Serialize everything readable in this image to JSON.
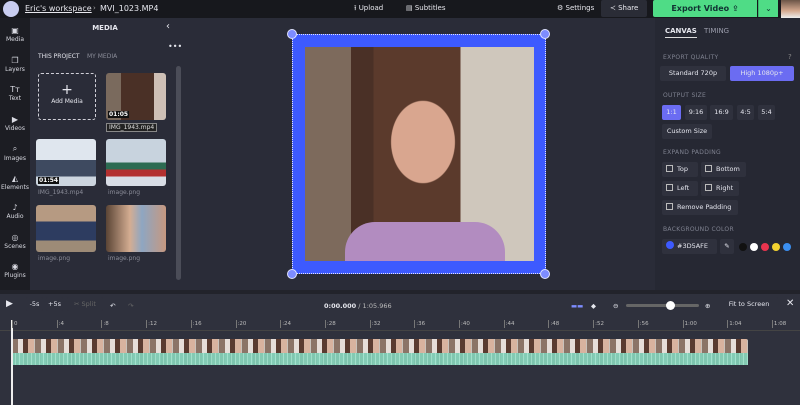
{
  "topbar": {
    "workspace": "Eric's workspace",
    "separator": "›",
    "filename": "MVI_1023.MP4",
    "upload": "Upload",
    "subtitles": "Subtitles",
    "settings": "Settings",
    "share": "Share",
    "export": "Export Video",
    "export_dropdown": "⌄"
  },
  "nav": [
    {
      "label": "Media",
      "icon": "media-icon"
    },
    {
      "label": "Layers",
      "icon": "layers-icon"
    },
    {
      "label": "Text",
      "icon": "text-icon"
    },
    {
      "label": "Videos",
      "icon": "videos-icon"
    },
    {
      "label": "Images",
      "icon": "images-icon"
    },
    {
      "label": "Elements",
      "icon": "elements-icon"
    },
    {
      "label": "Audio",
      "icon": "audio-icon"
    },
    {
      "label": "Scenes",
      "icon": "scenes-icon"
    },
    {
      "label": "Plugins",
      "icon": "plugins-icon"
    }
  ],
  "media": {
    "title": "MEDIA",
    "tabs": [
      "THIS PROJECT",
      "MY MEDIA"
    ],
    "add": "Add Media",
    "items": [
      {
        "name": "IMG_1943.mp4",
        "duration": "01:05"
      },
      {
        "name": "IMG_1943.mp4",
        "duration": "01:54"
      },
      {
        "name": "image.png"
      },
      {
        "name": "image.png"
      },
      {
        "name": "image.png"
      }
    ]
  },
  "right": {
    "tabs": [
      "CANVAS",
      "TIMING"
    ],
    "export_quality": "EXPORT QUALITY",
    "quality": [
      "Standard 720p",
      "High 1080p+"
    ],
    "quality_selected": "High 1080p+",
    "output_size": "OUTPUT SIZE",
    "sizes": [
      "1:1",
      "9:16",
      "16:9",
      "4:5",
      "5:4"
    ],
    "size_selected": "1:1",
    "custom": "Custom Size",
    "expand_padding": "EXPAND PADDING",
    "padding": [
      "Top",
      "Bottom",
      "Left",
      "Right",
      "Remove Padding"
    ],
    "background_color": "BACKGROUND COLOR",
    "bg_hex": "#3D5AFE",
    "swatches": [
      "#111111",
      "#ffffff",
      "#e8344e",
      "#f2d230",
      "#3b8ff0"
    ]
  },
  "timeline": {
    "back": "-5s",
    "fwd": "+5s",
    "split": "Split",
    "time": "0:00.000",
    "total": "/ 1:05.966",
    "fit": "Fit to Screen",
    "zoom_level": 0.6,
    "ticks": [
      "0",
      ":4",
      ":8",
      ":12",
      ":16",
      ":20",
      ":24",
      ":28",
      ":32",
      ":36",
      ":40",
      ":44",
      ":48",
      ":52",
      ":56",
      "1:00",
      "1:04",
      "1:08"
    ]
  }
}
